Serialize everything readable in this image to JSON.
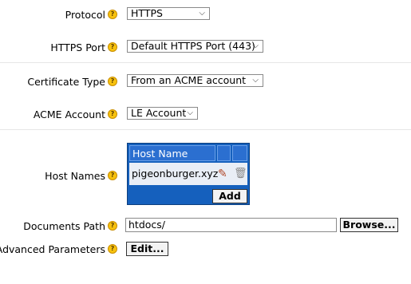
{
  "protocol": {
    "label": "Protocol",
    "value": "HTTPS"
  },
  "https_port": {
    "label": "HTTPS Port",
    "value": "Default HTTPS Port (443)"
  },
  "certificate_type": {
    "label": "Certificate Type",
    "value": "From an ACME account"
  },
  "acme_account": {
    "label": "ACME Account",
    "value": "LE Account"
  },
  "host_names": {
    "label": "Host Names",
    "column_header": "Host Name",
    "rows": [
      {
        "name": "pigeonburger.xyz"
      }
    ],
    "add_label": "Add"
  },
  "documents_path": {
    "label": "Documents Path",
    "value": "htdocs/",
    "browse_label": "Browse..."
  },
  "advanced": {
    "label": "Advanced Parameters",
    "edit_label": "Edit..."
  },
  "help_glyph": "?",
  "chevron_glyph": "⌵",
  "icons": {
    "help": "help-icon",
    "edit": "pencil-icon",
    "delete": "trash-icon"
  },
  "colors": {
    "table_bg": "#1560bd",
    "help_bg": "#f7c20e"
  }
}
